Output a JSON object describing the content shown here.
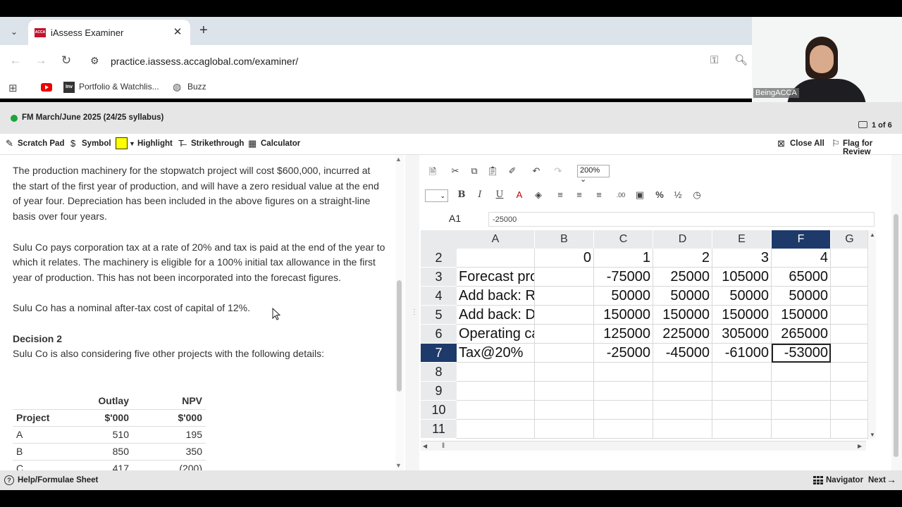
{
  "browser": {
    "tab_title": "iAssess Examiner",
    "tab_favicon_text": "ACCA",
    "url": "practice.iassess.accaglobal.com/examiner/",
    "bookmarks": [
      "Portfolio & Watchlis...",
      "Buzz"
    ],
    "bookmark_inv_text": "Inv"
  },
  "webcam": {
    "label": "BeingACCA"
  },
  "exam": {
    "title": "FM March/June 2025 (24/25 syllabus)",
    "question_counter": "1 of 6",
    "tools": {
      "scratch_pad": "Scratch Pad",
      "symbol": "Symbol",
      "highlight": "Highlight",
      "strikethrough": "Strikethrough",
      "calculator": "Calculator",
      "close_all": "Close All",
      "flag": "Flag for Review"
    }
  },
  "question": {
    "paragraphs": [
      "The production machinery for the stopwatch project will cost $600,000, incurred at the start of the first year of production, and will have a zero residual value at the end of year four. Depreciation has been included in the above figures on a straight-line basis over four years.",
      "Sulu Co pays corporation tax at a rate of 20% and tax is paid at the end of the year to which it relates. The machinery is eligible for a 100% initial tax allowance in the first year of production. This has not been incorporated into the forecast figures.",
      "Sulu Co has a nominal after-tax cost of capital of 12%."
    ],
    "decision_heading": "Decision 2",
    "decision_text": "Sulu Co is also considering five other projects with the following details:",
    "table": {
      "header_row1": [
        "",
        "Outlay",
        "NPV"
      ],
      "header_row2": [
        "Project",
        "$'000",
        "$'000"
      ],
      "rows": [
        [
          "A",
          "510",
          "195"
        ],
        [
          "B",
          "850",
          "350"
        ],
        [
          "C",
          "417",
          "(200)"
        ]
      ]
    }
  },
  "spreadsheet": {
    "zoom": "200%",
    "cell_ref": "A1",
    "formula_value": "-25000",
    "columns": [
      "A",
      "B",
      "C",
      "D",
      "E",
      "F",
      "G"
    ],
    "selected_column": "F",
    "selected_row": "7",
    "rows": [
      {
        "num": "2",
        "cells": [
          "",
          "0",
          "1",
          "2",
          "3",
          "4",
          ""
        ]
      },
      {
        "num": "3",
        "cells": [
          "Forecast profit",
          "",
          "-75000",
          "25000",
          "105000",
          "65000",
          ""
        ]
      },
      {
        "num": "4",
        "cells": [
          "Add back: R&D cost",
          "",
          "50000",
          "50000",
          "50000",
          "50000",
          ""
        ]
      },
      {
        "num": "5",
        "cells": [
          "Add back: Dep",
          "",
          "150000",
          "150000",
          "150000",
          "150000",
          ""
        ]
      },
      {
        "num": "6",
        "cells": [
          "Operating cash flow",
          "",
          "125000",
          "225000",
          "305000",
          "265000",
          ""
        ]
      },
      {
        "num": "7",
        "cells": [
          "Tax@20%",
          "",
          "-25000",
          "-45000",
          "-61000",
          "-53000",
          ""
        ]
      },
      {
        "num": "8",
        "cells": [
          "",
          "",
          "",
          "",
          "",
          "",
          ""
        ]
      },
      {
        "num": "9",
        "cells": [
          "",
          "",
          "",
          "",
          "",
          "",
          ""
        ]
      },
      {
        "num": "10",
        "cells": [
          "",
          "",
          "",
          "",
          "",
          "",
          ""
        ]
      },
      {
        "num": "11",
        "cells": [
          "",
          "",
          "",
          "",
          "",
          "",
          ""
        ]
      }
    ],
    "toolbar_text": {
      "percent": "%",
      "fraction": "½",
      "decimals": ".00"
    }
  },
  "footer": {
    "help": "Help/Formulae Sheet",
    "navigator": "Navigator",
    "next": "Next"
  },
  "colors": {
    "selected_header": "#1d3a6b",
    "highlight_yellow": "#ffff00",
    "status_green": "#1fa33a"
  }
}
